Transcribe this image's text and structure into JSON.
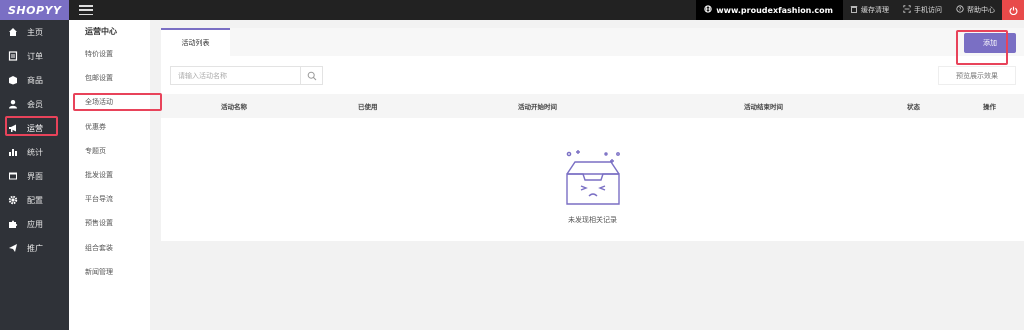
{
  "app": {
    "logo": "SHOPYY"
  },
  "topbar": {
    "site": "www.proudexfashion.com",
    "cache_label": "缓存清理",
    "mobile_label": "手机访问",
    "help_label": "帮助中心"
  },
  "sidebar": {
    "items": [
      {
        "label": "主页",
        "icon": "home-icon"
      },
      {
        "label": "订单",
        "icon": "order-icon"
      },
      {
        "label": "商品",
        "icon": "box-icon"
      },
      {
        "label": "会员",
        "icon": "user-icon"
      },
      {
        "label": "运营",
        "icon": "megaphone-icon"
      },
      {
        "label": "统计",
        "icon": "bar-chart-icon"
      },
      {
        "label": "界面",
        "icon": "layout-icon"
      },
      {
        "label": "配置",
        "icon": "gear-icon"
      },
      {
        "label": "应用",
        "icon": "puzzle-icon"
      },
      {
        "label": "推广",
        "icon": "send-icon"
      }
    ]
  },
  "submenu": {
    "title": "运营中心",
    "items": [
      "特价设置",
      "包邮设置",
      "全场活动",
      "优惠券",
      "专题页",
      "批发设置",
      "平台导流",
      "预售设置",
      "组合套装",
      "新闻管理"
    ]
  },
  "main": {
    "tab_label": "活动列表",
    "add_label": "添加",
    "search_placeholder": "请输入活动名称",
    "preview_label": "预览展示效果",
    "columns": [
      "活动名称",
      "已使用",
      "活动开始时间",
      "活动结束时间",
      "状态",
      "操作"
    ],
    "empty_text": "未发现相关记录"
  },
  "colors": {
    "accent": "#7a6fc4",
    "highlight": "#e8435a",
    "sidebar_bg": "#2f3238"
  }
}
